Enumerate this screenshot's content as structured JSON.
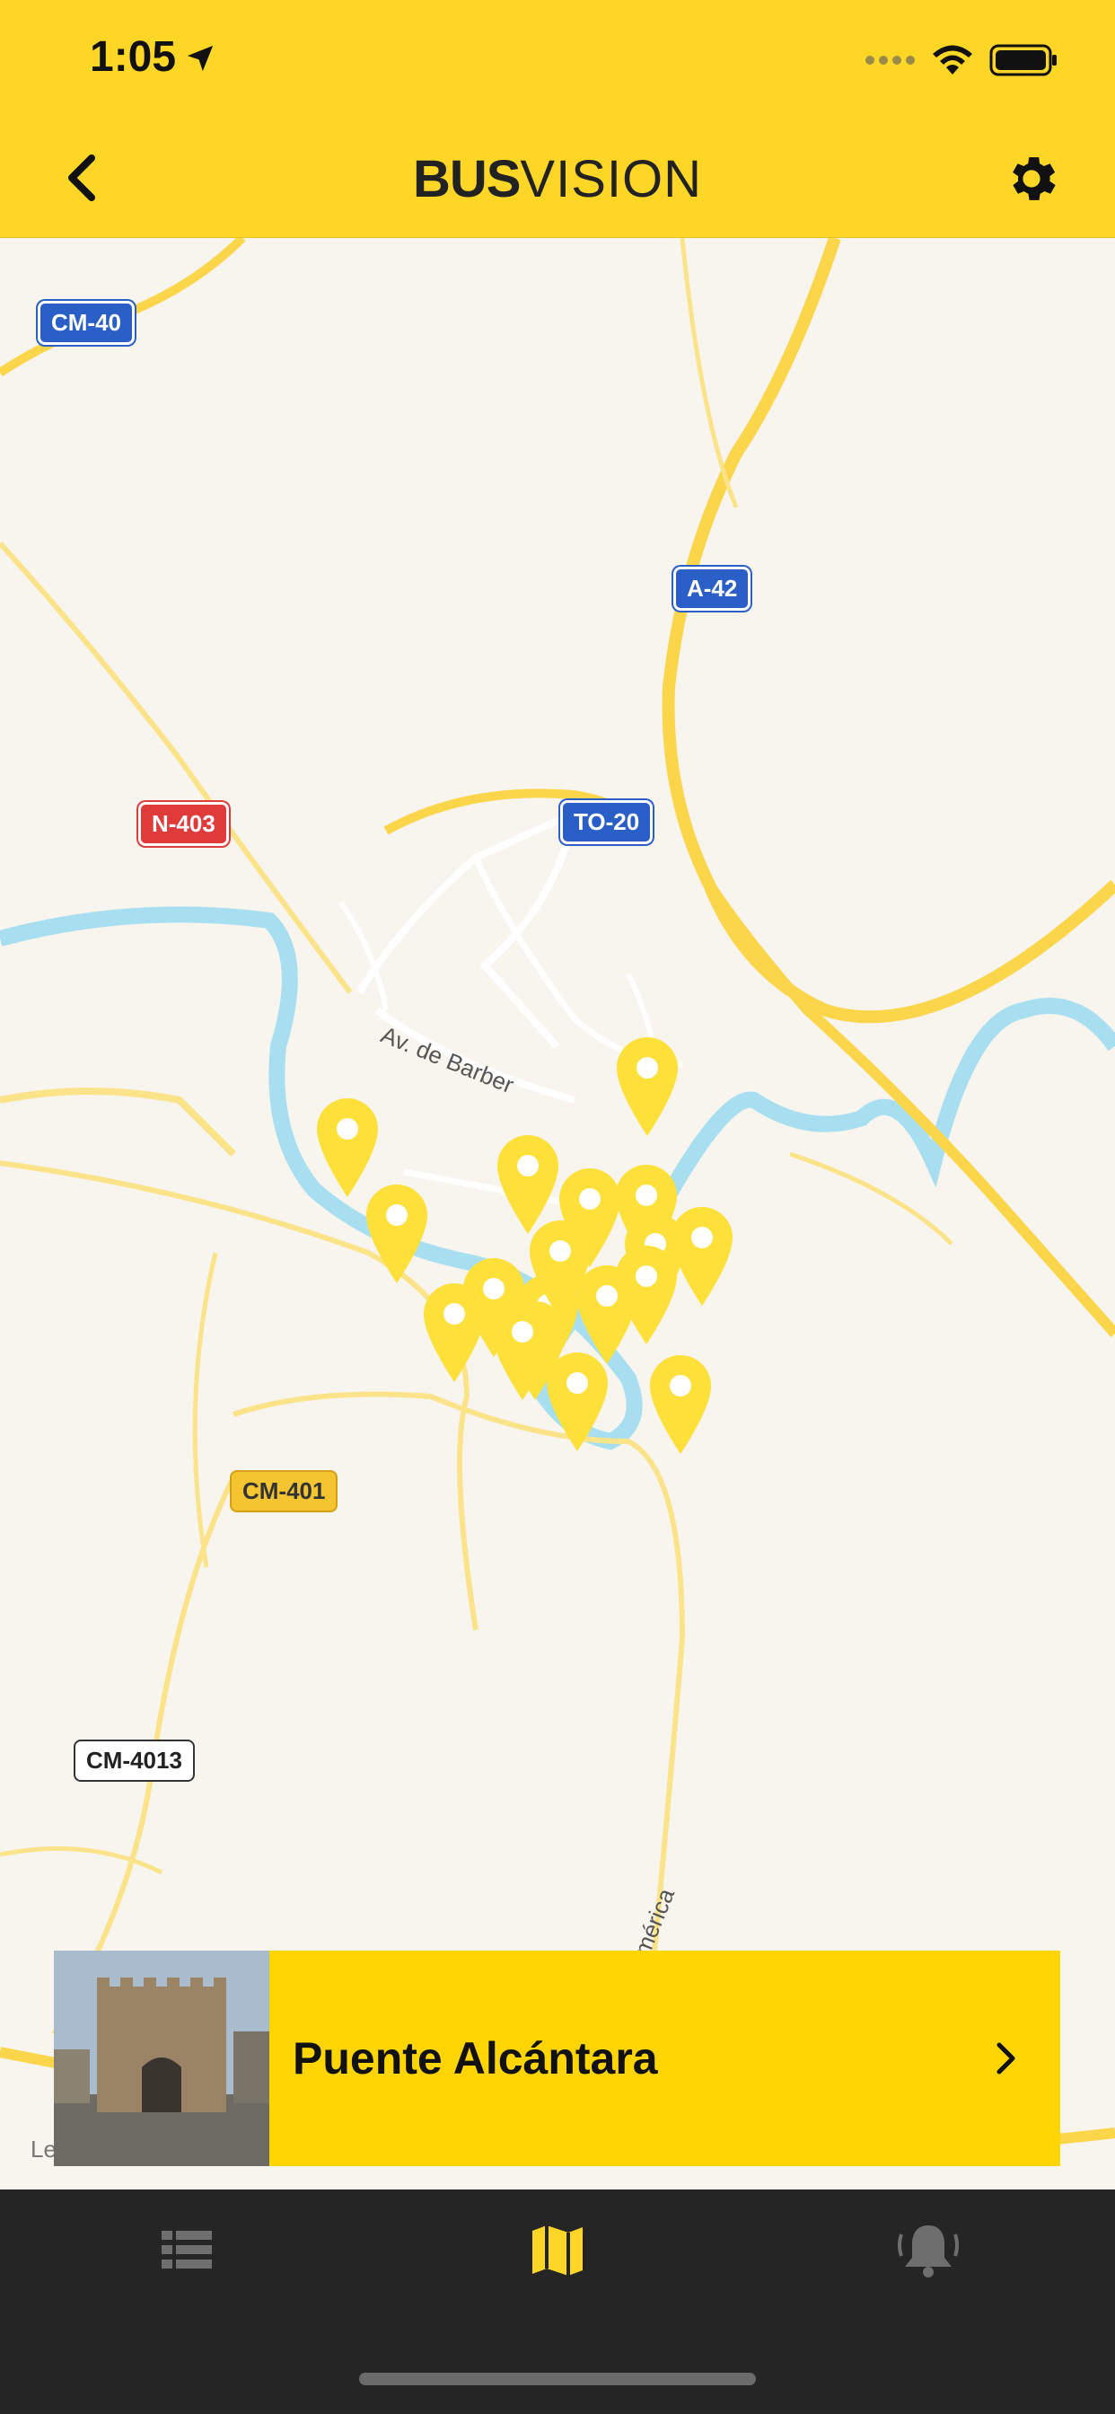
{
  "status": {
    "time": "1:05"
  },
  "nav": {
    "logo_bold": "BUS",
    "logo_light": "VISION"
  },
  "map": {
    "road_labels": [
      "CM-40",
      "A-42",
      "N-403",
      "TO-20",
      "CM-401",
      "CM-4013"
    ],
    "street_labels": [
      "Av. de Barber",
      "mérica"
    ],
    "legal": "Le"
  },
  "stop_card": {
    "title": "Puente Alcántara"
  },
  "tabs": {
    "list_icon": "list-icon",
    "map_icon": "map-icon",
    "alerts_icon": "bell-icon"
  },
  "colors": {
    "brand_yellow": "#fdd626",
    "card_yellow": "#fed500",
    "tabbar": "#252525",
    "active_tab": "#fdd626"
  }
}
